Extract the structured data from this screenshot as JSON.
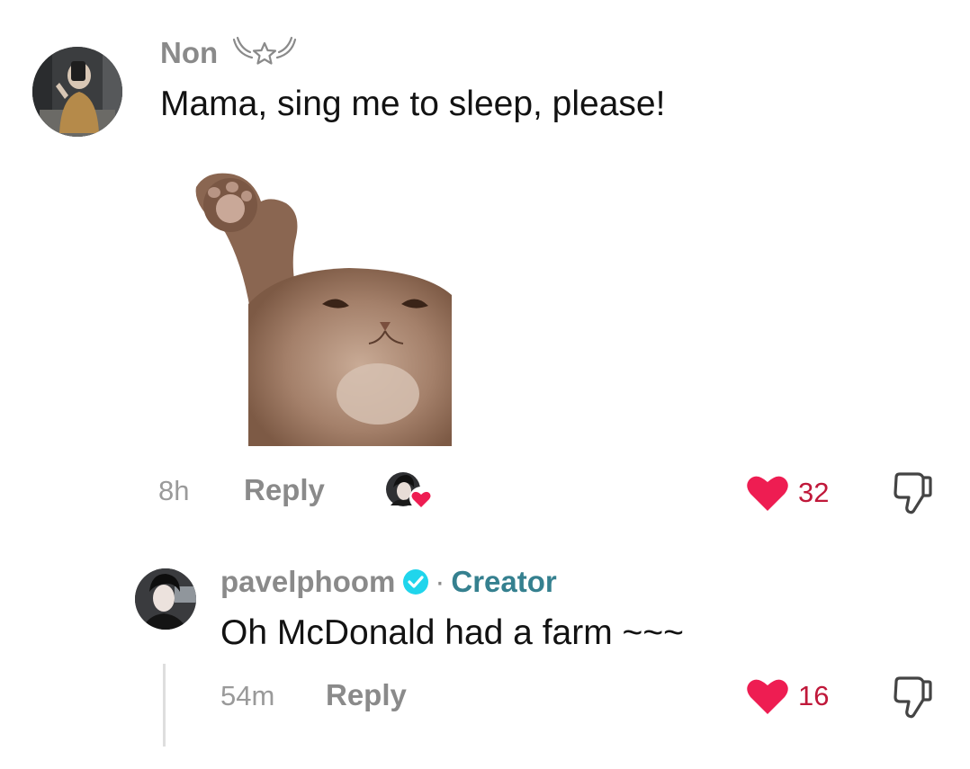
{
  "comment": {
    "author": "Non",
    "author_badge_icon": "wings-star-icon",
    "text": "Mama, sing me to sleep, please!",
    "sticker": "cat-waving-sticker",
    "time": "8h",
    "reply_label": "Reply",
    "creator_liked_icon": "creator-liked-avatar-icon",
    "likes": "32",
    "like_color": "#ee1d52"
  },
  "reply": {
    "author": "pavelphoom",
    "verified_icon": "verified-check-icon",
    "separator": "·",
    "role_tag": "Creator",
    "role_color": "#35808f",
    "text": "Oh McDonald had a farm ~~~",
    "time": "54m",
    "reply_label": "Reply",
    "likes": "16"
  }
}
